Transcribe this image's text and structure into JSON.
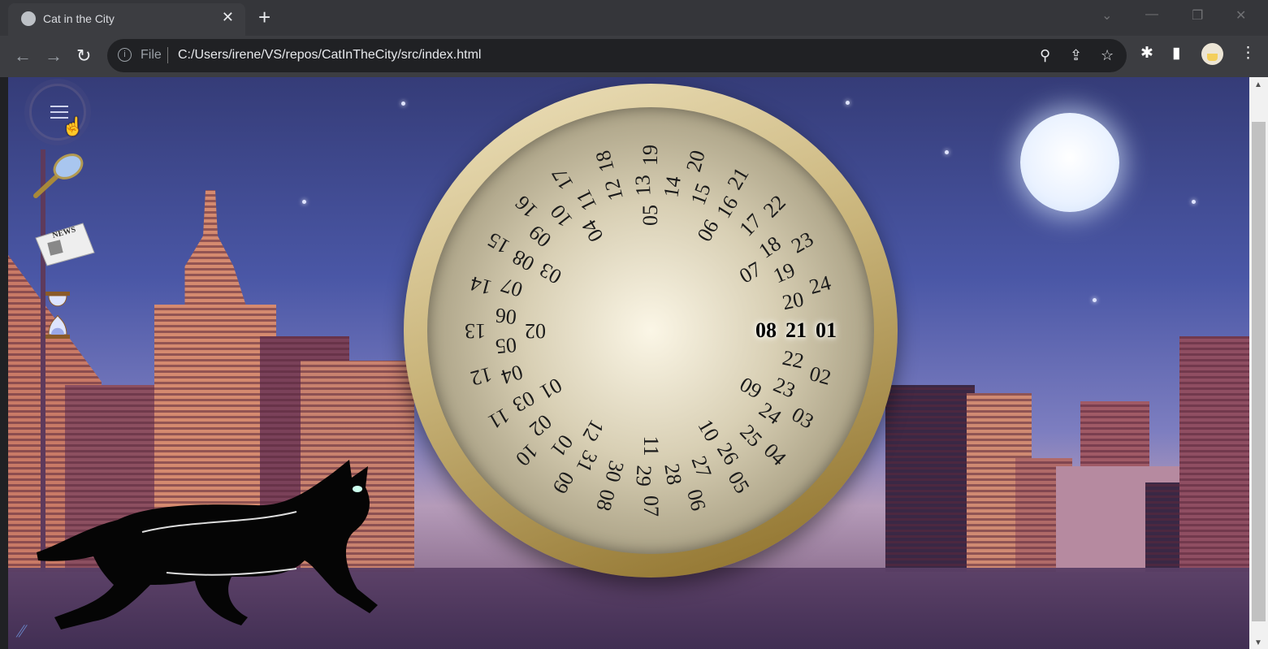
{
  "browser": {
    "tab_title": "Cat in the City",
    "url_scheme_label": "File",
    "url": "C:/Users/irene/VS/repos/CatInTheCity/src/index.html"
  },
  "sidebar": {
    "items": [
      {
        "icon": "menu-icon"
      },
      {
        "icon": "magnifier-icon"
      },
      {
        "icon": "newspaper-icon",
        "label": "NEWS"
      },
      {
        "icon": "hourglass-icon"
      }
    ]
  },
  "dial": {
    "selected": {
      "month": "08",
      "day": "21",
      "hour": "01"
    },
    "months": [
      "01",
      "02",
      "03",
      "04",
      "05",
      "06",
      "07",
      "08",
      "09",
      "10",
      "11",
      "12"
    ],
    "days": [
      "01",
      "02",
      "03",
      "04",
      "05",
      "06",
      "07",
      "08",
      "09",
      "10",
      "11",
      "12",
      "13",
      "14",
      "15",
      "16",
      "17",
      "18",
      "19",
      "20",
      "21",
      "22",
      "23",
      "24",
      "25",
      "26",
      "27",
      "28",
      "29",
      "30",
      "31"
    ],
    "hours": [
      "01",
      "02",
      "03",
      "04",
      "05",
      "06",
      "07",
      "08",
      "09",
      "10",
      "11",
      "12",
      "13",
      "14",
      "15",
      "16",
      "17",
      "18",
      "19",
      "20",
      "21",
      "22",
      "23",
      "24"
    ]
  },
  "colors": {
    "sky": "#4a57a6",
    "dial_rim": "#c9b47a",
    "moon": "#eaf2ff"
  }
}
